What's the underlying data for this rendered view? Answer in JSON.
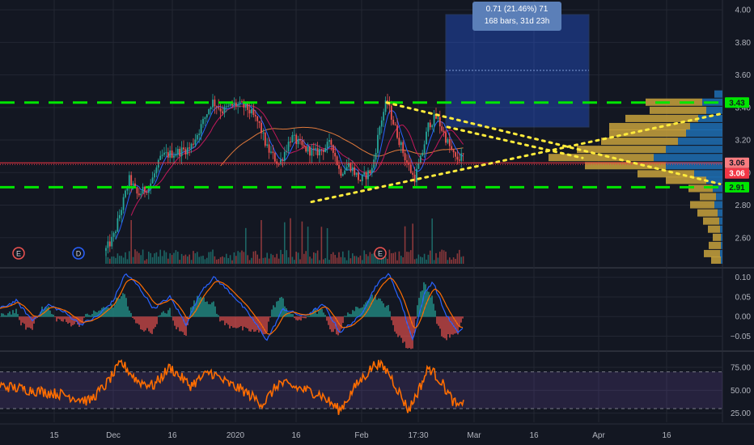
{
  "chart_data": {
    "type": "candlestick",
    "main": {
      "ylim": [
        2.44,
        4.06
      ],
      "y_ticks": [
        4.0,
        3.8,
        3.6,
        3.4,
        3.2,
        3.0,
        2.8,
        2.6
      ],
      "y_tick_labels": [
        "4.00",
        "3.80",
        "3.60",
        "3.40",
        "3.20",
        "3.00",
        "2.80",
        "2.60"
      ],
      "support_resistance": [
        {
          "price": 3.43,
          "label": "3.43",
          "color": "#00e600"
        },
        {
          "price": 2.91,
          "label": "2.91",
          "color": "#00e600"
        }
      ],
      "price_line": {
        "price": 3.06,
        "color": "#f23645"
      },
      "price_tags": [
        {
          "price": 3.06,
          "label": "3.06",
          "bg": "#f77c80",
          "fg": "#131722"
        },
        {
          "price": 3.06,
          "label": "3.06",
          "bg": "#f23645",
          "fg": "#ffffff"
        },
        {
          "price": 2.91,
          "label": "2.91",
          "bg": "#00e600",
          "fg": "#131722"
        }
      ],
      "measure": {
        "line1": "0.71 (21.46%) 71",
        "line2": "168 bars, 31d 23h"
      },
      "event_markers": [
        "E",
        "D",
        "E"
      ]
    },
    "macd": {
      "ylim": [
        -0.08,
        0.12
      ],
      "y_ticks": [
        0.1,
        0.05,
        0.0,
        -0.05
      ],
      "y_tick_labels": [
        "0.10",
        "0.05",
        "0.00",
        "−0.05"
      ]
    },
    "rsi": {
      "ylim": [
        15,
        90
      ],
      "y_ticks": [
        75,
        50,
        25
      ],
      "y_tick_labels": [
        "75.00",
        "50.00",
        "25.00"
      ],
      "bands": [
        70,
        30
      ]
    },
    "x_labels": [
      "15",
      "Dec",
      "16",
      "2020",
      "16",
      "Feb",
      "17:30",
      "Mar",
      "16",
      "Apr",
      "16"
    ]
  },
  "colors": {
    "up": "#26a69a",
    "down": "#ef5350",
    "bg": "#131722",
    "grid": "#232733"
  }
}
